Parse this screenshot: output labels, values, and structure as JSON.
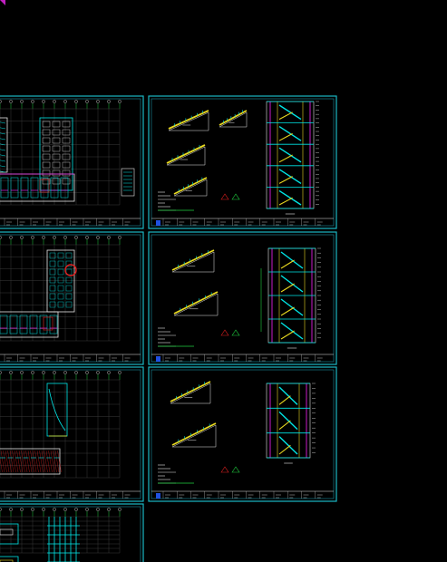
{
  "canvas": {
    "background": "#000000",
    "sheet_border_color": "#1ab8c4",
    "sheet_inner_color": "#1a8fa0",
    "colors": {
      "cyan": "#00e5e5",
      "yellow": "#e8d820",
      "magenta": "#e020e0",
      "white": "#e6e6e6",
      "green": "#20d040",
      "red": "#e02020",
      "blue": "#2050e0",
      "grid": "#3a3a3a"
    }
  },
  "sheets": [
    {
      "id": "plan-1",
      "kind": "floor-plan",
      "variant": "wing-with-tower"
    },
    {
      "id": "stair-1",
      "kind": "stair-detail",
      "variant": "five-flight"
    },
    {
      "id": "plan-2",
      "kind": "floor-plan",
      "variant": "grid-with-marker"
    },
    {
      "id": "stair-2",
      "kind": "stair-detail",
      "variant": "four-flight"
    },
    {
      "id": "plan-3",
      "kind": "floor-plan",
      "variant": "hatched-corridor"
    },
    {
      "id": "stair-3",
      "kind": "stair-detail",
      "variant": "three-flight"
    },
    {
      "id": "plan-4",
      "kind": "floor-plan",
      "variant": "partial"
    }
  ]
}
